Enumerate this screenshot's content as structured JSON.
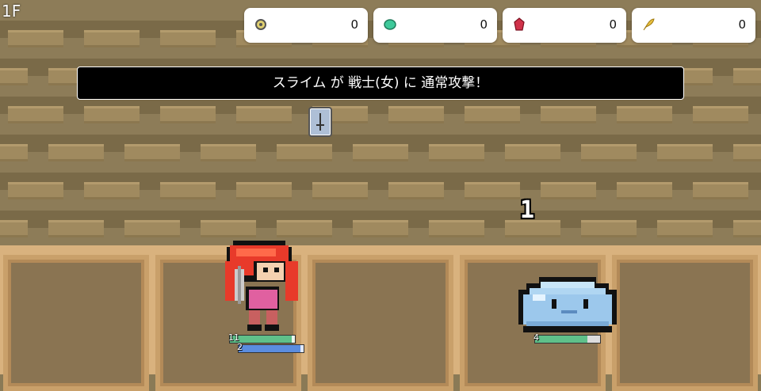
{
  "hud": {
    "floor": "1F"
  },
  "resources": [
    {
      "icon": "coin-icon",
      "value": "0",
      "color": "#c8b040"
    },
    {
      "icon": "green-gem-icon",
      "value": "0",
      "color": "#3ec99a"
    },
    {
      "icon": "red-gem-icon",
      "value": "0",
      "color": "#d0324a"
    },
    {
      "icon": "feather-icon",
      "value": "0",
      "color": "#e8c040"
    }
  ],
  "battle": {
    "message": "スライム が 戦士(女) に 通常攻撃！",
    "damage": "1"
  },
  "hero": {
    "name": "warrior-female",
    "hp": "11",
    "hp_fraction": 0.95,
    "mp": "2",
    "mp_fraction": 0.95,
    "hp_color": "#5fc08a",
    "mp_color": "#5b8de0"
  },
  "enemy": {
    "name": "slime",
    "hp": "4",
    "hp_fraction": 0.8,
    "hp_color": "#5fc08a"
  }
}
